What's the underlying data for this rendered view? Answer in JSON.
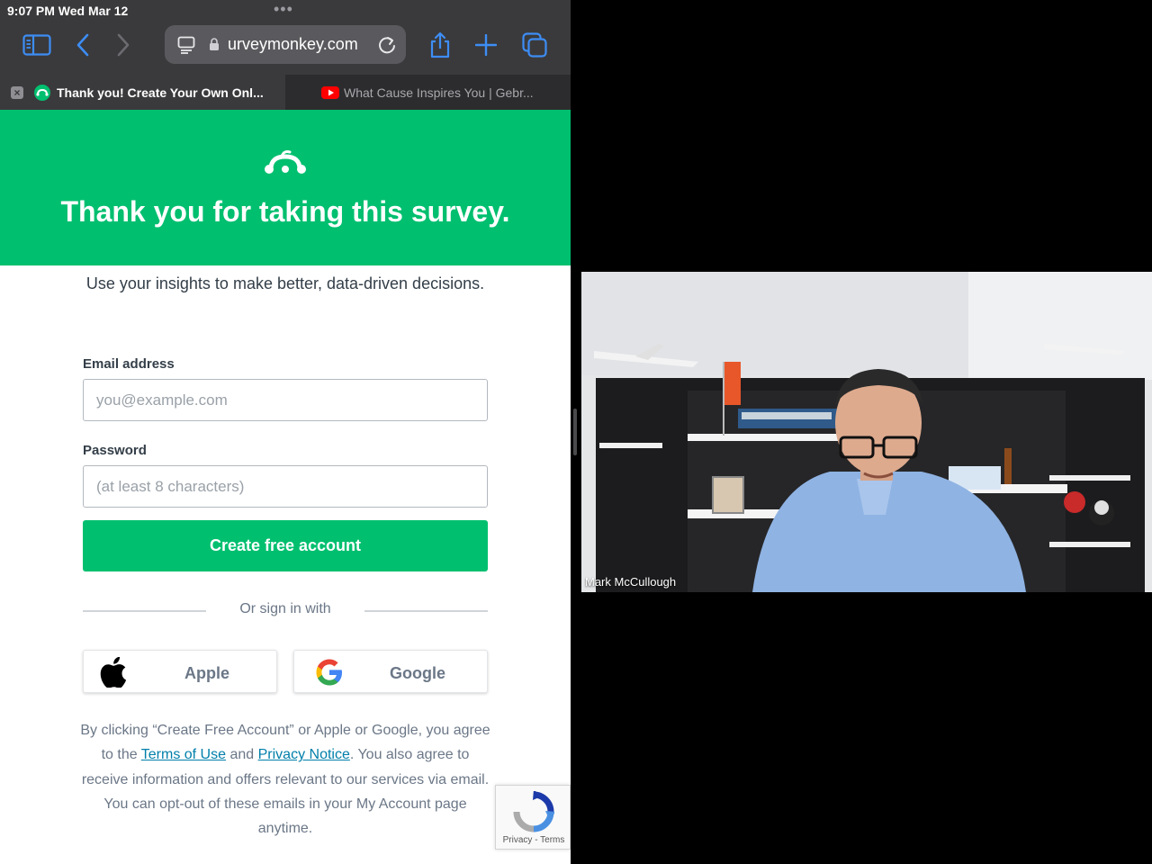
{
  "status_bar": {
    "time": "9:07 PM  Wed Mar 12",
    "dots": "•••"
  },
  "browser": {
    "address": "urveymonkey.com",
    "tabs": [
      {
        "title": "Thank you! Create Your Own Onl...",
        "active": true,
        "favicon": "surveymonkey-favicon"
      },
      {
        "title": "What Cause Inspires You | Gebr...",
        "active": false,
        "favicon": "youtube-favicon"
      }
    ]
  },
  "page": {
    "hero_title": "Thank you for taking this survey.",
    "lead_text": "Use your insights to make better, data-driven decisions.",
    "email_label": "Email address",
    "email_placeholder": "you@example.com",
    "password_label": "Password",
    "password_placeholder": "(at least 8 characters)",
    "create_button": "Create free account",
    "or_sign_in": "Or sign in with",
    "apple_label": "Apple",
    "google_label": "Google",
    "legal": {
      "part1": "By clicking “Create Free Account” or Apple or Google, you agree to the ",
      "terms_link": "Terms of Use",
      "part2": " and ",
      "privacy_link": "Privacy Notice",
      "part3": ". You also agree to receive information and offers relevant to our services via email. You can opt-out of these emails in your My Account page anytime."
    },
    "recaptcha_text": "Privacy - Terms"
  },
  "video": {
    "participant_name": "Mark McCullough"
  },
  "colors": {
    "brand_green": "#00bf6f",
    "link_blue": "#007faa",
    "safari_blue": "#3d8df5"
  }
}
